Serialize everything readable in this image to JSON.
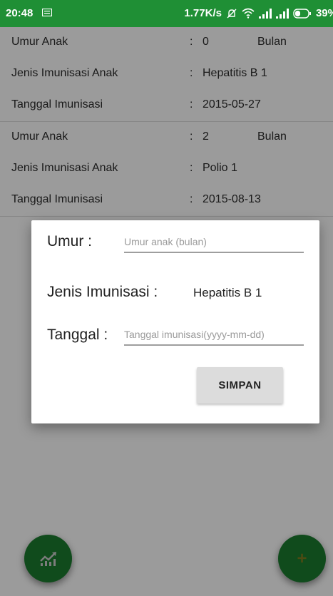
{
  "status_bar": {
    "time": "20:48",
    "network_speed": "1.77K/s",
    "battery": "39%"
  },
  "records": [
    {
      "age_label": "Umur Anak",
      "age_value": "0",
      "age_unit": "Bulan",
      "type_label": "Jenis Imunisasi Anak",
      "type_value": "Hepatitis B 1",
      "date_label": "Tanggal Imunisasi",
      "date_value": "2015-05-27"
    },
    {
      "age_label": "Umur Anak",
      "age_value": "2",
      "age_unit": "Bulan",
      "type_label": "Jenis Imunisasi Anak",
      "type_value": "Polio 1",
      "date_label": "Tanggal Imunisasi",
      "date_value": "2015-08-13"
    }
  ],
  "separator": ":",
  "dialog": {
    "age_label": "Umur :",
    "age_placeholder": "Umur anak (bulan)",
    "type_label": "Jenis Imunisasi :",
    "type_value": "Hepatitis B 1",
    "date_label": "Tanggal :",
    "date_placeholder": "Tanggal imunisasi(yyyy-mm-dd)",
    "save_label": "SIMPAN"
  },
  "fabs": {
    "left_icon": "chart-icon",
    "right_icon": "add-icon",
    "right_symbol": "+"
  },
  "colors": {
    "primary_green": "#1f8f35",
    "fab_green": "#1b7a2e"
  }
}
